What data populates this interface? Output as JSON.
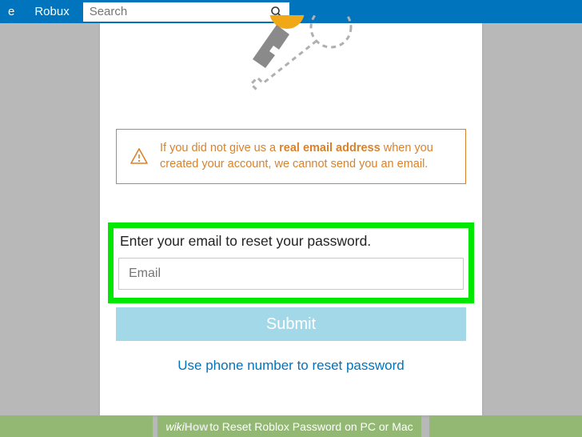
{
  "topbar": {
    "nav_left": "e",
    "nav_robux": "Robux",
    "search_placeholder": "Search"
  },
  "warning": {
    "text_before": "If you did not give us a ",
    "bold": "real email address",
    "text_after": " when you created your account, we cannot send you an email."
  },
  "form": {
    "prompt": "Enter your email to reset your password.",
    "email_placeholder": "Email",
    "submit_label": "Submit",
    "alt_link": "Use phone number to reset password"
  },
  "wikihow": {
    "brand_prefix": "wiki",
    "brand_suffix": "How",
    "title": " to Reset Roblox Password on PC or Mac"
  }
}
